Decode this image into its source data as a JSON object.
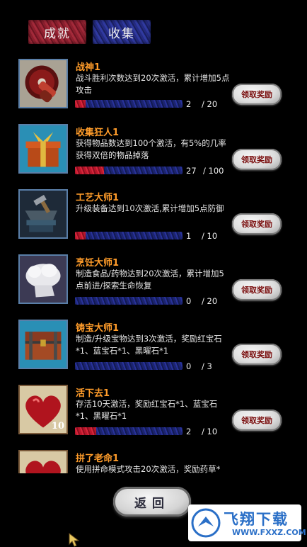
{
  "tabs": {
    "achievements": "成就",
    "collection": "收集"
  },
  "claim_label": "领取奖励",
  "back_label": "返回",
  "watermark": {
    "name": "飞翔下载",
    "url": "WWW.FXXZ.COM"
  },
  "items": [
    {
      "title": "战神1",
      "desc": "战斗胜利次数达到20次激活，累计增加5点攻击",
      "current": "2",
      "total": "/ 20",
      "progress": 0.1,
      "icon": "saw-blade-icon"
    },
    {
      "title": "收集狂人1",
      "desc": "获得物品数达到100个激活，有5%的几率获得双倍的物品掉落",
      "current": "27",
      "total": "/ 100",
      "progress": 0.27,
      "icon": "gift-box-icon"
    },
    {
      "title": "工艺大师1",
      "desc": "升级装备达到10次激活,累计增加5点防御",
      "current": "1",
      "total": "/ 10",
      "progress": 0.1,
      "icon": "anvil-icon"
    },
    {
      "title": "烹饪大师1",
      "desc": "制造食品/药物达到20次激活，累计增加5点前进/探索生命恢复",
      "current": "0",
      "total": "/ 20",
      "progress": 0.0,
      "icon": "chef-hat-icon"
    },
    {
      "title": "铸宝大师1",
      "desc": "制造/升级宝物达到3次激活，奖励红宝石*1、蓝宝石*1、黑曜石*1",
      "current": "0",
      "total": "/ 3",
      "progress": 0.0,
      "icon": "treasure-chest-icon"
    },
    {
      "title": "活下去1",
      "desc": "存活10天激活，奖励红宝石*1、蓝宝石*1、黑曜石*1",
      "current": "2",
      "total": "/ 10",
      "progress": 0.2,
      "icon": "heart-icon",
      "badge": "10"
    },
    {
      "title": "拼了老命1",
      "desc": "使用拼命模式攻击20次激活，奖励药草*",
      "current": "",
      "total": "",
      "progress": 0.0,
      "icon": "heart-icon"
    }
  ]
}
